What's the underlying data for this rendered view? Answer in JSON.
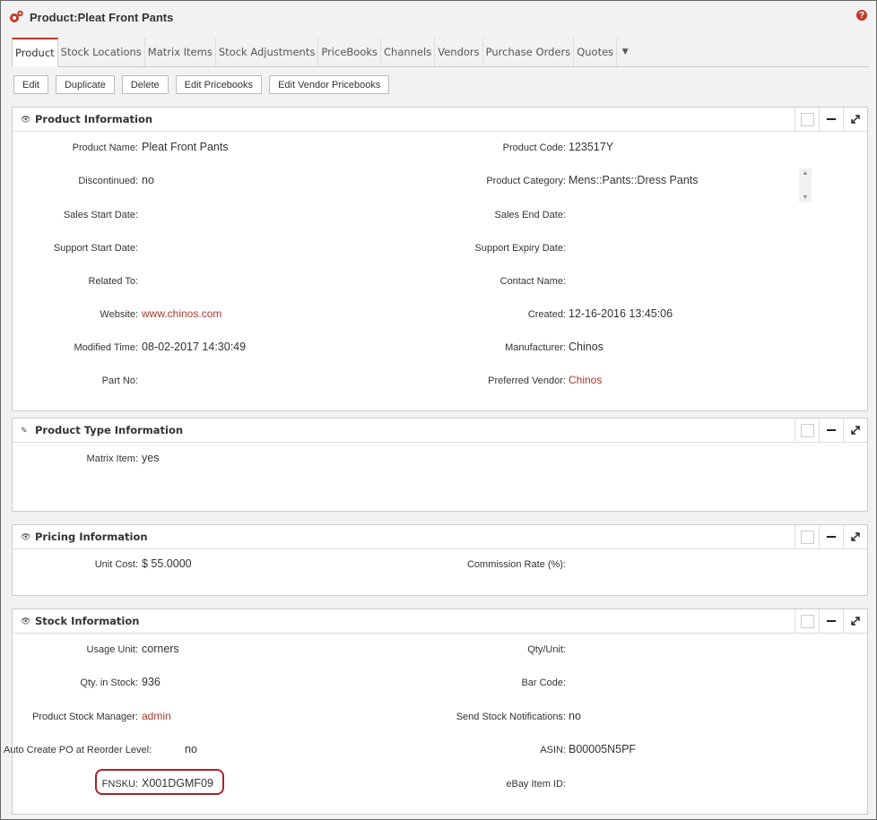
{
  "header": {
    "title": "Product:Pleat Front Pants",
    "help_glyph": "?"
  },
  "tabs": [
    {
      "label": "Product",
      "active": true
    },
    {
      "label": "Stock Locations"
    },
    {
      "label": "Matrix Items"
    },
    {
      "label": "Stock Adjustments"
    },
    {
      "label": "PriceBooks"
    },
    {
      "label": "Channels"
    },
    {
      "label": "Vendors"
    },
    {
      "label": "Purchase Orders"
    },
    {
      "label": "Quotes"
    }
  ],
  "tab_more_glyph": "▼",
  "toolbar": {
    "edit": "Edit",
    "duplicate": "Duplicate",
    "delete": "Delete",
    "edit_pricebooks": "Edit Pricebooks",
    "edit_vendor_pricebooks": "Edit Vendor Pricebooks"
  },
  "product_info": {
    "title": "Product Information",
    "fields": {
      "product_name": {
        "label": "Product Name:",
        "value": "Pleat Front Pants"
      },
      "product_code": {
        "label": "Product Code:",
        "value": "123517Y"
      },
      "discontinued": {
        "label": "Discontinued:",
        "value": "no"
      },
      "product_category": {
        "label": "Product Category:",
        "value": "Mens::Pants::Dress Pants"
      },
      "sales_start": {
        "label": "Sales Start Date:",
        "value": ""
      },
      "sales_end": {
        "label": "Sales End Date:",
        "value": ""
      },
      "support_start": {
        "label": "Support Start Date:",
        "value": ""
      },
      "support_expiry": {
        "label": "Support Expiry Date:",
        "value": ""
      },
      "related_to": {
        "label": "Related To:",
        "value": ""
      },
      "contact_name": {
        "label": "Contact Name:",
        "value": ""
      },
      "website": {
        "label": "Website:",
        "value": "www.chinos.com"
      },
      "created": {
        "label": "Created:",
        "value": "12-16-2016 13:45:06"
      },
      "modified": {
        "label": "Modified Time:",
        "value": "08-02-2017 14:30:49"
      },
      "manufacturer": {
        "label": "Manufacturer:",
        "value": "Chinos"
      },
      "part_no": {
        "label": "Part No:",
        "value": ""
      },
      "preferred_vendor": {
        "label": "Preferred Vendor:",
        "value": "Chinos"
      }
    }
  },
  "product_type_info": {
    "title": "Product Type Information",
    "fields": {
      "matrix_item": {
        "label": "Matrix Item:",
        "value": "yes"
      }
    }
  },
  "pricing_info": {
    "title": "Pricing Information",
    "fields": {
      "unit_cost": {
        "label": "Unit Cost:",
        "value": "$ 55.0000"
      },
      "commission_rate": {
        "label": "Commission Rate (%):",
        "value": ""
      }
    }
  },
  "stock_info": {
    "title": "Stock Information",
    "fields": {
      "usage_unit": {
        "label": "Usage Unit:",
        "value": "corners"
      },
      "qty_unit": {
        "label": "Qty/Unit:",
        "value": ""
      },
      "qty_in_stock": {
        "label": "Qty. in Stock:",
        "value": "936"
      },
      "bar_code": {
        "label": "Bar Code:",
        "value": ""
      },
      "stock_manager": {
        "label": "Product Stock Manager:",
        "value": "admin"
      },
      "send_notifications": {
        "label": "Send Stock Notifications:",
        "value": "no"
      },
      "auto_create_po": {
        "label": "Auto Create PO at Reorder Level:",
        "value": "no"
      },
      "asin": {
        "label": "ASIN:",
        "value": "B00005N5PF"
      },
      "fnsku": {
        "label": "FNSKU:",
        "value": "X001DGMF09"
      },
      "ebay_item_id": {
        "label": "eBay Item ID:",
        "value": ""
      }
    }
  },
  "colors": {
    "accent": "#c0392b",
    "link": "#a83a2e",
    "highlight": "#a8232b"
  }
}
